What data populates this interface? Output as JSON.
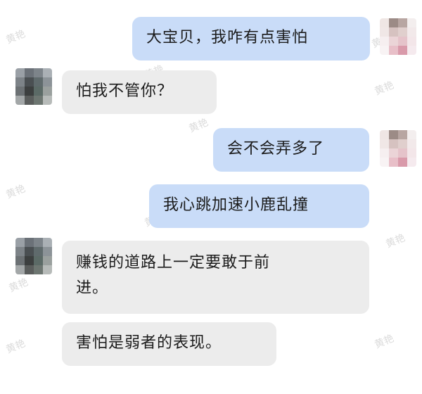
{
  "messages": [
    {
      "from": "me",
      "text": "大宝贝，我咋有点害怕"
    },
    {
      "from": "them",
      "text": "怕我不管你？"
    },
    {
      "from": "me",
      "text": "会不会弄多了"
    },
    {
      "from": "me",
      "text": "我心跳加速小鹿乱撞"
    },
    {
      "from": "them",
      "text": "赚钱的道路上一定要敢于前\n进。"
    },
    {
      "from": "them",
      "text": "害怕是弱者的表现。"
    }
  ],
  "watermark": "黄艳",
  "colors": {
    "outgoing_bubble": "#c9dcf8",
    "incoming_bubble": "#ececec",
    "text": "#1b1b1b"
  }
}
